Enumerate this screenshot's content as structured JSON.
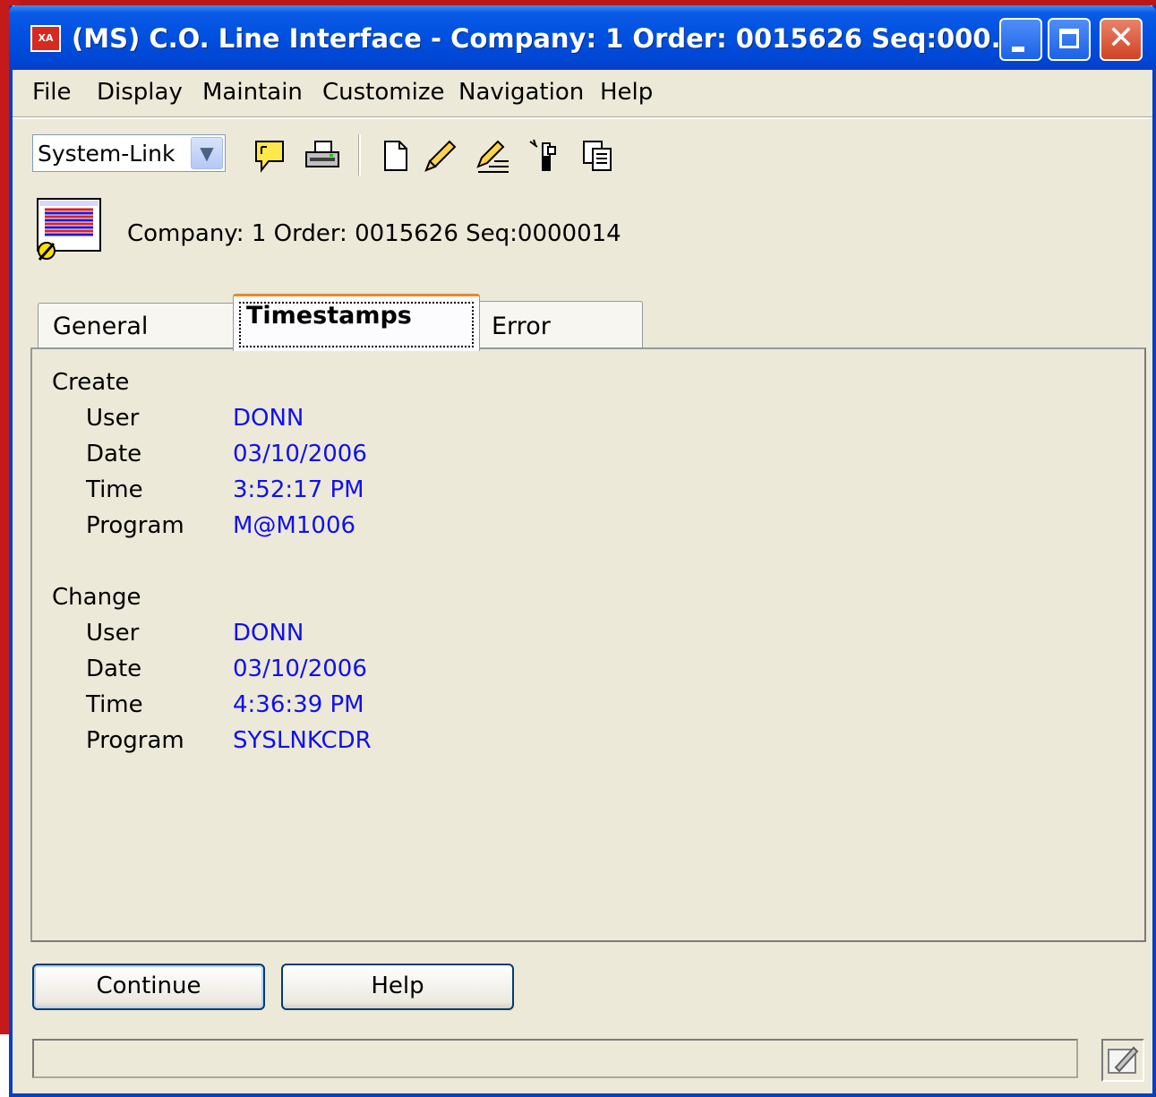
{
  "window": {
    "title": "(MS) C.O. Line Interface - Company: 1  Order: 0015626 Seq:000...",
    "app_icon_text": "XA"
  },
  "menu": [
    "File",
    "Display",
    "Maintain",
    "Customize",
    "Navigation",
    "Help"
  ],
  "toolbar": {
    "combo_value": "System-Link",
    "icons": [
      "notes-icon",
      "print-icon",
      "new-icon",
      "edit-icon",
      "edit-lines-icon",
      "delete-icon",
      "copy-icon"
    ]
  },
  "header": {
    "label": "Company: 1  Order: 0015626 Seq:0000014"
  },
  "tabs": [
    {
      "label": "General",
      "active": false
    },
    {
      "label": "Timestamps",
      "active": true
    },
    {
      "label": "Error",
      "active": false
    }
  ],
  "create": {
    "title": "Create",
    "user_label": "User",
    "user": "DONN",
    "date_label": "Date",
    "date": "03/10/2006",
    "time_label": "Time",
    "time": "3:52:17 PM",
    "program_label": "Program",
    "program": "M@M1006"
  },
  "change": {
    "title": "Change",
    "user_label": "User",
    "user": "DONN",
    "date_label": "Date",
    "date": "03/10/2006",
    "time_label": "Time",
    "time": "4:36:39 PM",
    "program_label": "Program",
    "program": "SYSLNKCDR"
  },
  "buttons": {
    "continue": "Continue",
    "help": "Help"
  },
  "colors": {
    "title_bar": "#0050e0",
    "value_text": "#1010ee",
    "window_bg": "#ece9d8"
  }
}
